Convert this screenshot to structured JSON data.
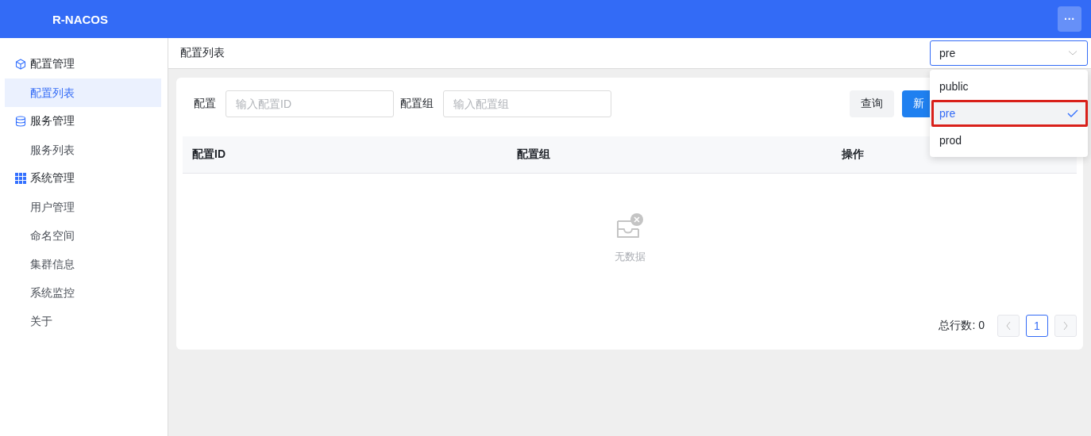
{
  "header": {
    "title": "R-NACOS",
    "more_button": "···"
  },
  "sidebar": {
    "groups": [
      {
        "label": "配置管理",
        "kind": "cube",
        "children": [
          {
            "label": "配置列表",
            "selected": true
          }
        ]
      },
      {
        "label": "服务管理",
        "kind": "database",
        "children": [
          {
            "label": "服务列表",
            "selected": false
          }
        ]
      },
      {
        "label": "系统管理",
        "kind": "grid",
        "children": [
          {
            "label": "用户管理",
            "selected": false
          },
          {
            "label": "命名空间",
            "selected": false
          },
          {
            "label": "集群信息",
            "selected": false
          },
          {
            "label": "系统监控",
            "selected": false
          },
          {
            "label": "关于",
            "selected": false
          }
        ]
      }
    ]
  },
  "page_title": "配置列表",
  "namespace_select": {
    "value": "pre",
    "expanded": true,
    "options": [
      {
        "label": "public",
        "selected": false,
        "highlighted": false
      },
      {
        "label": "pre",
        "selected": true,
        "highlighted": true
      },
      {
        "label": "prod",
        "selected": false,
        "highlighted": false
      }
    ]
  },
  "filters": [
    {
      "label": "配置",
      "placeholder": "输入配置ID"
    },
    {
      "label": "配置组",
      "placeholder": "输入配置组"
    }
  ],
  "buttons": [
    {
      "label": "查询",
      "kind": "default"
    },
    {
      "label": "新",
      "kind": "primary"
    }
  ],
  "table": {
    "columns": [
      "配置ID",
      "配置组",
      "操作"
    ],
    "empty_text": "无数据"
  },
  "pagination": {
    "total": "总行数: 0",
    "pages": [
      {
        "label": "1",
        "selected": true
      }
    ]
  }
}
